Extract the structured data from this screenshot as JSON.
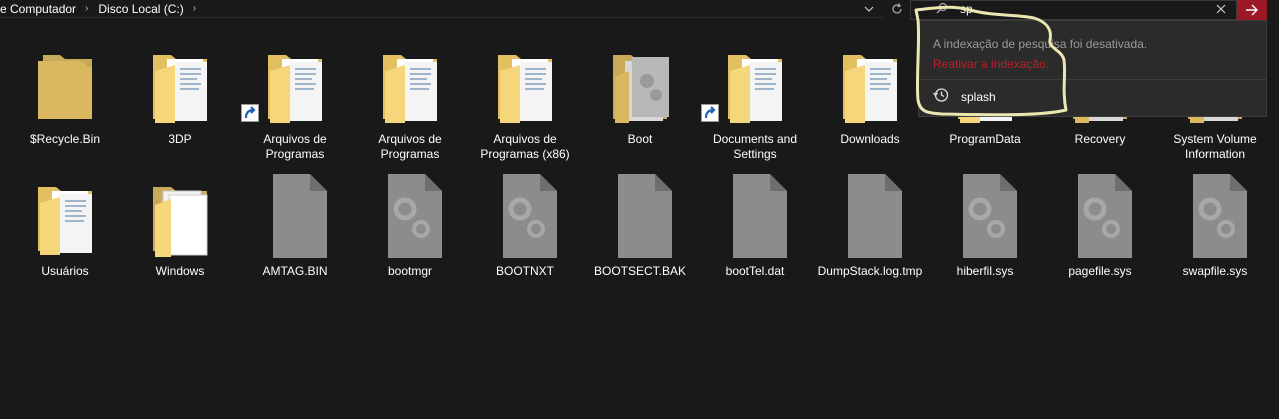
{
  "breadcrumb": {
    "items": [
      "e Computador",
      "Disco Local (C:)"
    ],
    "separator": "›",
    "trailing_chevron": "›"
  },
  "address_dropdown_icon": "chevron-down-icon",
  "refresh_icon": "refresh-icon",
  "search": {
    "value": "sp",
    "clear_icon": "close-icon",
    "go_icon": "arrow-right-icon",
    "accent_color": "#9b1824"
  },
  "search_dropdown": {
    "message": "A indexação de pesquisa foi desativada.",
    "link": "Reativar a indexação.",
    "history_item": "splash",
    "link_color": "#c01e2a"
  },
  "items_row1": [
    {
      "label": "$Recycle.Bin",
      "icon": "folder-empty-icon"
    },
    {
      "label": "3DP",
      "icon": "folder-docs-icon"
    },
    {
      "label": "Arquivos de Programas",
      "icon": "folder-docs-icon",
      "shortcut": true
    },
    {
      "label": "Arquivos de Programas",
      "icon": "folder-docs-icon"
    },
    {
      "label": "Arquivos de Programas (x86)",
      "icon": "folder-docs-icon"
    },
    {
      "label": "Boot",
      "icon": "folder-system-icon"
    },
    {
      "label": "Documents and Settings",
      "icon": "folder-docs-icon",
      "shortcut": true
    },
    {
      "label": "Downloads",
      "icon": "folder-docs-icon"
    },
    {
      "label": "ProgramData",
      "icon": "folder-docs-icon"
    },
    {
      "label": "Recovery",
      "icon": "folder-system-icon"
    },
    {
      "label": "System Volume Information",
      "icon": "folder-system-icon"
    }
  ],
  "items_row2": [
    {
      "label": "Usuários",
      "icon": "folder-docs-icon"
    },
    {
      "label": "Windows",
      "icon": "folder-white-icon"
    },
    {
      "label": "AMTAG.BIN",
      "icon": "file-icon"
    },
    {
      "label": "bootmgr",
      "icon": "system-file-icon"
    },
    {
      "label": "BOOTNXT",
      "icon": "system-file-icon"
    },
    {
      "label": "BOOTSECT.BAK",
      "icon": "file-icon"
    },
    {
      "label": "bootTel.dat",
      "icon": "file-icon"
    },
    {
      "label": "DumpStack.log.tmp",
      "icon": "file-icon"
    },
    {
      "label": "hiberfil.sys",
      "icon": "system-file-icon"
    },
    {
      "label": "pagefile.sys",
      "icon": "system-file-icon"
    },
    {
      "label": "swapfile.sys",
      "icon": "system-file-icon"
    }
  ],
  "colors": {
    "background": "#191919",
    "folder_yellow": "#f5d67a",
    "folder_dark": "#d9b85f",
    "file_gray": "#8c8c8c"
  }
}
